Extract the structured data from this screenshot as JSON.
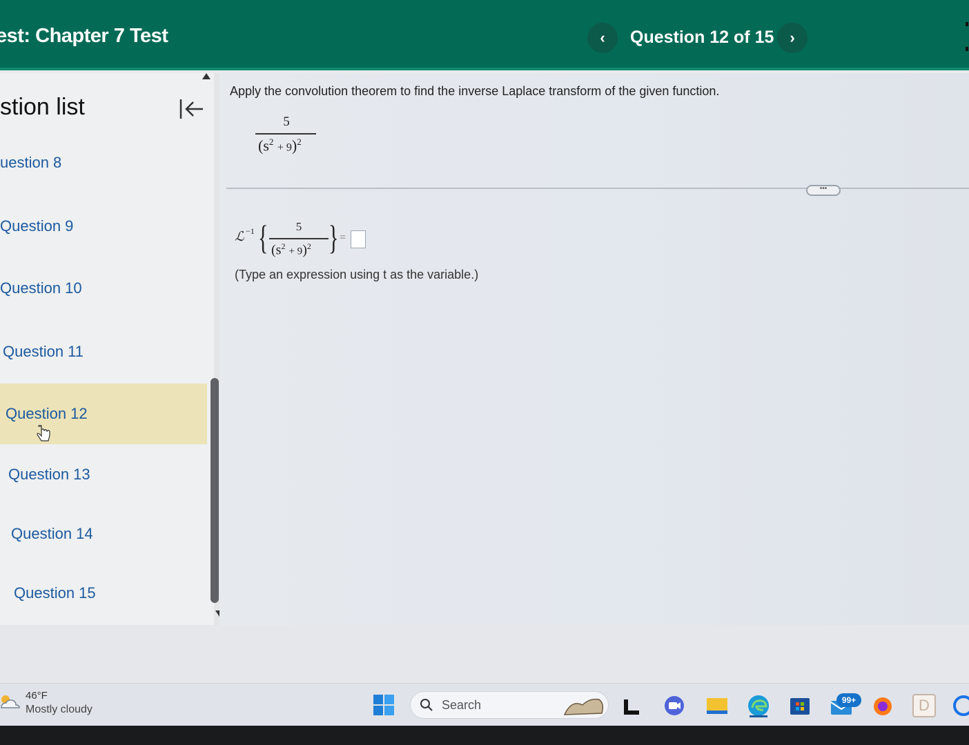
{
  "header": {
    "test_title": "est:  Chapter 7 Test",
    "question_counter": "Question 12 of 15",
    "prev_glyph": "‹",
    "next_glyph": "›"
  },
  "sidebar": {
    "title": "stion list",
    "items": [
      {
        "label": "uestion 8",
        "active": false
      },
      {
        "label": "Question 9",
        "active": false
      },
      {
        "label": "Question 10",
        "active": false
      },
      {
        "label": "Question 11",
        "active": false
      },
      {
        "label": "Question 12",
        "active": true
      },
      {
        "label": "Question 13",
        "active": false
      },
      {
        "label": "Question 14",
        "active": false
      },
      {
        "label": "Question 15",
        "active": false
      }
    ]
  },
  "question": {
    "prompt": "Apply the convolution theorem to find the inverse Laplace transform of the given function.",
    "numerator": "5",
    "denom_base": "s",
    "denom_exp": "2",
    "denom_const": "+ 9",
    "outer_exp": "2",
    "laplace_symbol": "ℒ",
    "inverse_exp": "−1",
    "equals": "=",
    "answer_value": "",
    "hint": "(Type an expression using t as the variable.)",
    "more_label": "•••"
  },
  "taskbar": {
    "weather_temp": "46°F",
    "weather_desc": "Mostly cloudy",
    "search_placeholder": "Search",
    "badge_count": "99+",
    "d_label": "D"
  },
  "colors": {
    "header_bg": "#036a55",
    "active_item_bg": "#ece3b8",
    "link_blue": "#1d5aa0"
  }
}
